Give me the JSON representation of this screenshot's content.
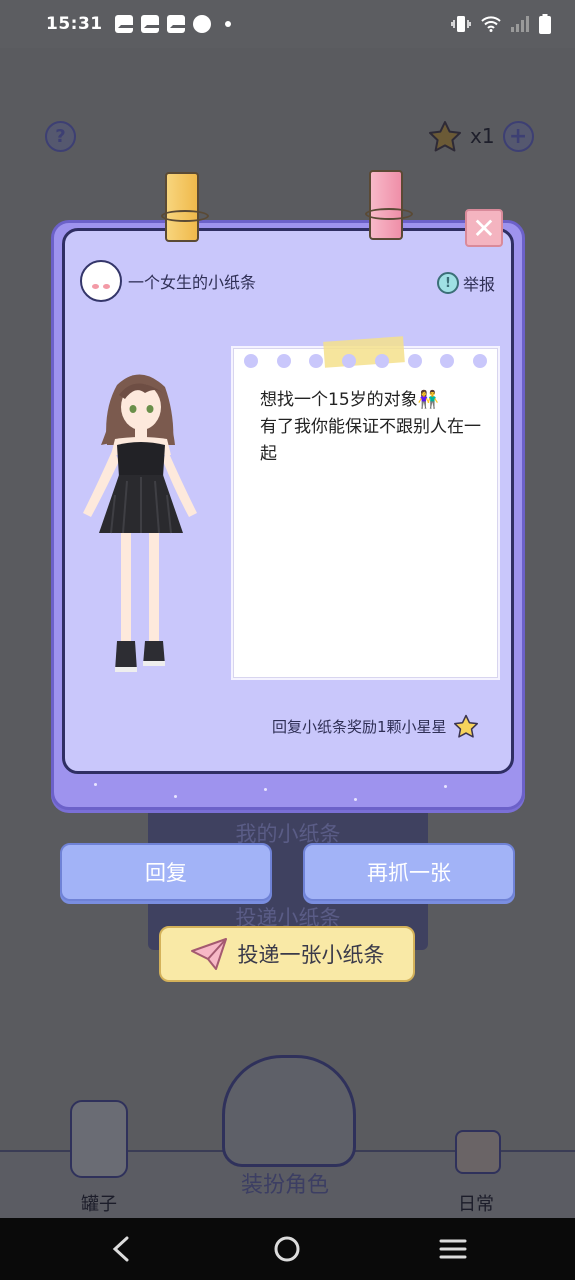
{
  "status_bar": {
    "time": "15:31"
  },
  "top_bar": {
    "help_icon": "question-icon",
    "star_count": "x1",
    "add_icon": "plus-icon"
  },
  "background_menu": {
    "item1": "我的小纸条",
    "item2": "投递小纸条"
  },
  "note_card": {
    "author_name": "一个女生的小纸条",
    "report_label": "举报",
    "message": "想找一个15岁的对象👫\n有了我你能保证不跟别人在一起",
    "reward_text": "回复小纸条奖励1颗小星星",
    "close_icon": "close-icon"
  },
  "actions": {
    "reply": "回复",
    "grab_again": "再抓一张",
    "post_note": "投递一张小纸条"
  },
  "bottom_nav": {
    "jar": "罐子",
    "dress_up": "装扮角色",
    "daily": "日常"
  },
  "colors": {
    "modal_bg": "#c9c7fb",
    "modal_border": "#9e93ee",
    "button_blue": "#a2b3f7",
    "post_yellow": "#f9e9a6"
  }
}
